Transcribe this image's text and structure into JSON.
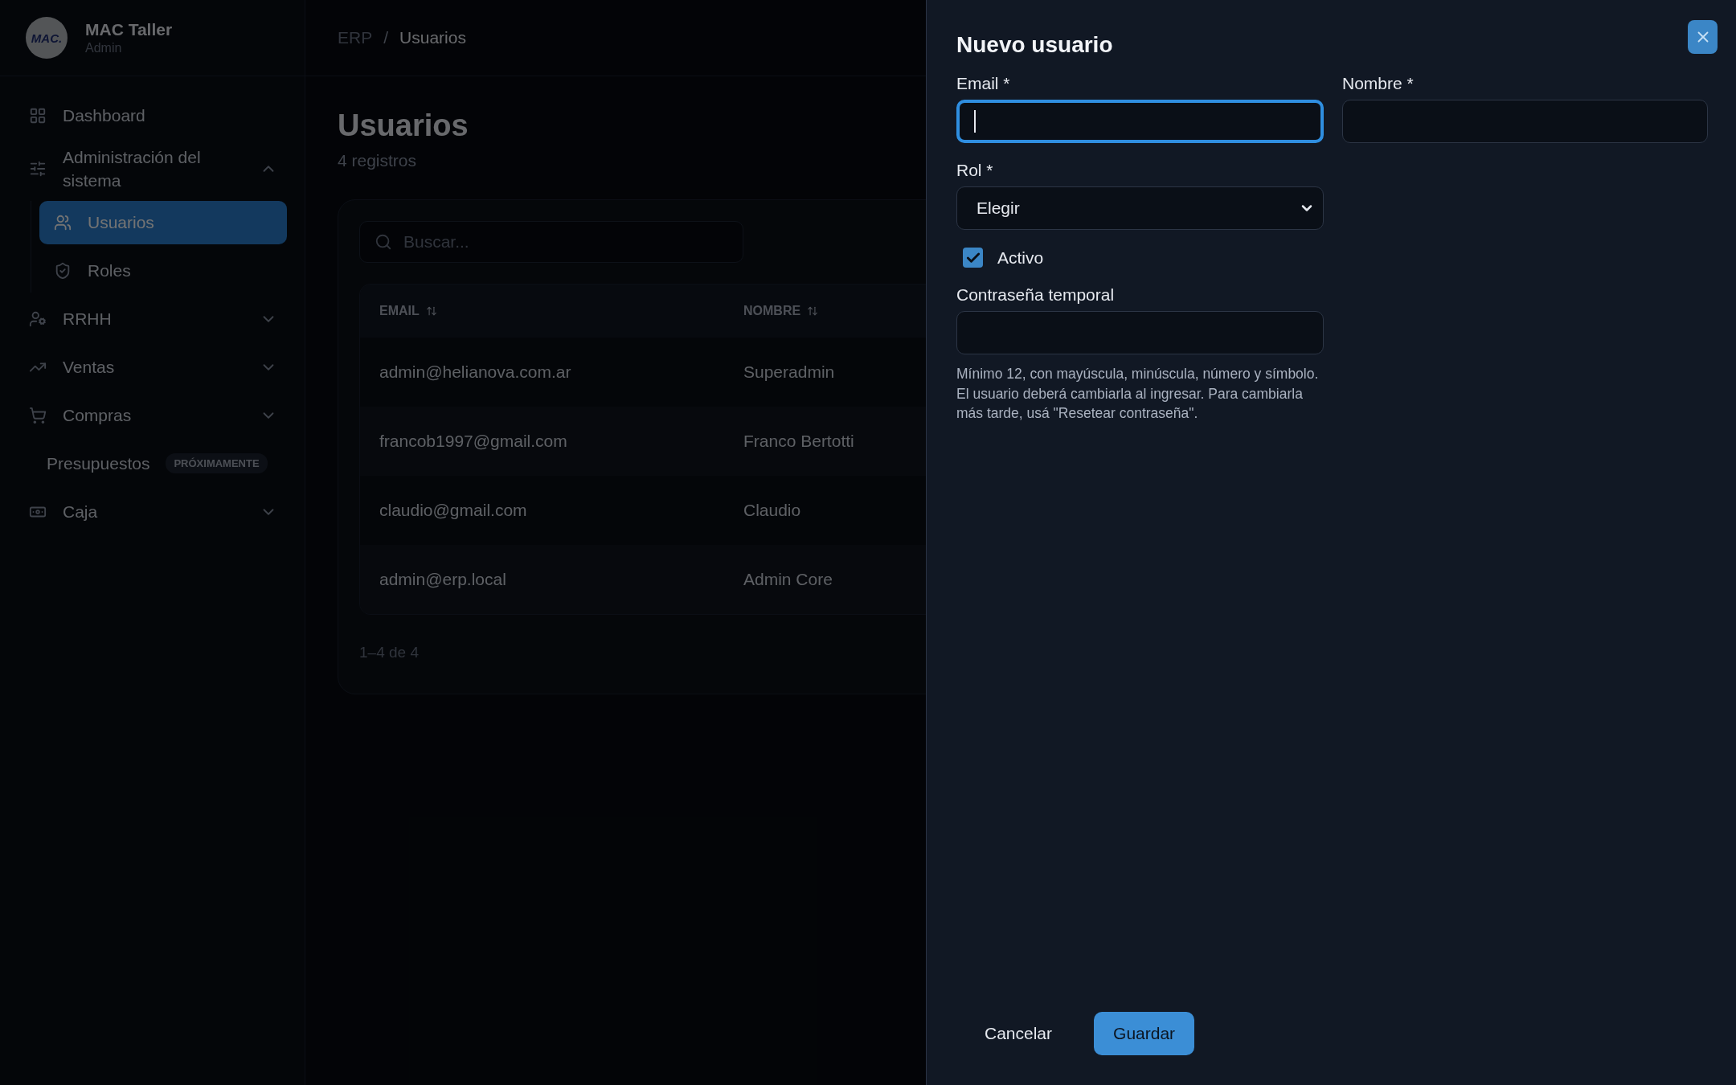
{
  "sidebar": {
    "brand": {
      "logo": "MAC.",
      "name": "MAC Taller",
      "role": "Admin"
    },
    "items": [
      {
        "kind": "link",
        "label": "Dashboard",
        "selected": false
      },
      {
        "kind": "group",
        "label": "Administración del sistema",
        "expanded": true,
        "selected": false,
        "children": [
          {
            "label": "Usuarios",
            "selected": true
          },
          {
            "label": "Roles",
            "selected": false
          }
        ]
      },
      {
        "kind": "group",
        "label": "RRHH",
        "expanded": false,
        "selected": false
      },
      {
        "kind": "group",
        "label": "Ventas",
        "expanded": false,
        "selected": false
      },
      {
        "kind": "group",
        "label": "Compras",
        "expanded": false,
        "selected": false
      },
      {
        "kind": "soon",
        "label": "Presupuestos",
        "badge": "PRÓXIMAMENTE",
        "selected": false
      },
      {
        "kind": "group",
        "label": "Caja",
        "expanded": false,
        "selected": false
      }
    ]
  },
  "breadcrumb": {
    "items": [
      "ERP",
      "Usuarios"
    ],
    "separator": "/"
  },
  "page": {
    "title": "Usuarios",
    "subtitle": "4 registros"
  },
  "search": {
    "placeholder": "Buscar..."
  },
  "table": {
    "columns": [
      "EMAIL",
      "NOMBRE"
    ],
    "rows": [
      [
        "admin@helianova.com.ar",
        "Superadmin"
      ],
      [
        "francob1997@gmail.com",
        "Franco Bertotti"
      ],
      [
        "claudio@gmail.com",
        "Claudio"
      ],
      [
        "admin@erp.local",
        "Admin Core"
      ]
    ]
  },
  "pagination": "1–4 de 4",
  "drawer": {
    "title": "Nuevo usuario",
    "fields": [
      {
        "kind": "text",
        "label": "Email *",
        "focused": true
      },
      {
        "kind": "text",
        "label": "Nombre *",
        "focused": false
      },
      {
        "kind": "select",
        "label": "Rol *",
        "value": "Elegir"
      },
      {
        "kind": "checkbox",
        "label": "Activo",
        "checked": true
      },
      {
        "kind": "password",
        "label": "Contraseña temporal",
        "focused": false,
        "hint": "Mínimo 12, con mayúscula, minúscula, número y símbolo. El usuario deberá cambiarla al ingresar. Para cambiarla más tarde, usá \"Resetear contraseña\"."
      }
    ],
    "buttons": [
      "Cancelar",
      "Guardar"
    ]
  }
}
